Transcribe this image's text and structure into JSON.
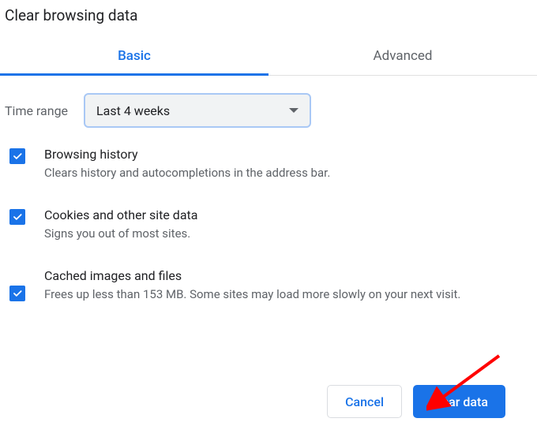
{
  "dialog": {
    "title": "Clear browsing data"
  },
  "tabs": {
    "basic": "Basic",
    "advanced": "Advanced"
  },
  "range": {
    "label": "Time range",
    "value": "Last 4 weeks"
  },
  "options": [
    {
      "checked": true,
      "label": "Browsing history",
      "desc": "Clears history and autocompletions in the address bar."
    },
    {
      "checked": true,
      "label": "Cookies and other site data",
      "desc": "Signs you out of most sites."
    },
    {
      "checked": true,
      "label": "Cached images and files",
      "desc": "Frees up less than 153 MB. Some sites may load more slowly on your next visit."
    }
  ],
  "buttons": {
    "cancel": "Cancel",
    "clear": "Clear data"
  },
  "annotations": {
    "arrow_color": "#ff0000"
  }
}
